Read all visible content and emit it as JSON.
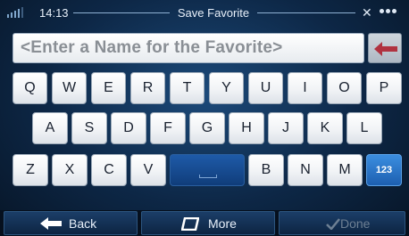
{
  "status": {
    "time": "14:13",
    "title": "Save Favorite",
    "gps_icon": "gps-satellite-icon",
    "signal_icon": "signal-bars-icon",
    "menu_dots_icon": "menu-dots-icon"
  },
  "input": {
    "placeholder": "<Enter a Name for the Favorite>",
    "backspace_icon": "backspace-arrow-icon"
  },
  "keyboard": {
    "row1": [
      "Q",
      "W",
      "E",
      "R",
      "T",
      "Y",
      "U",
      "I",
      "O",
      "P"
    ],
    "row2": [
      "A",
      "S",
      "D",
      "F",
      "G",
      "H",
      "J",
      "K",
      "L"
    ],
    "row3": [
      "Z",
      "X",
      "C",
      "V",
      "B",
      "N",
      "M"
    ],
    "space_icon": "space-bar-icon",
    "num_label": "123"
  },
  "nav": {
    "back_label": "Back",
    "more_label": "More",
    "done_label": "Done",
    "back_icon": "arrow-left-icon",
    "more_icon": "more-icon",
    "done_icon": "checkmark-icon"
  },
  "colors": {
    "accent": "#1d5fb0",
    "background": "#0d2746",
    "backspace_arrow": "#b03240"
  }
}
